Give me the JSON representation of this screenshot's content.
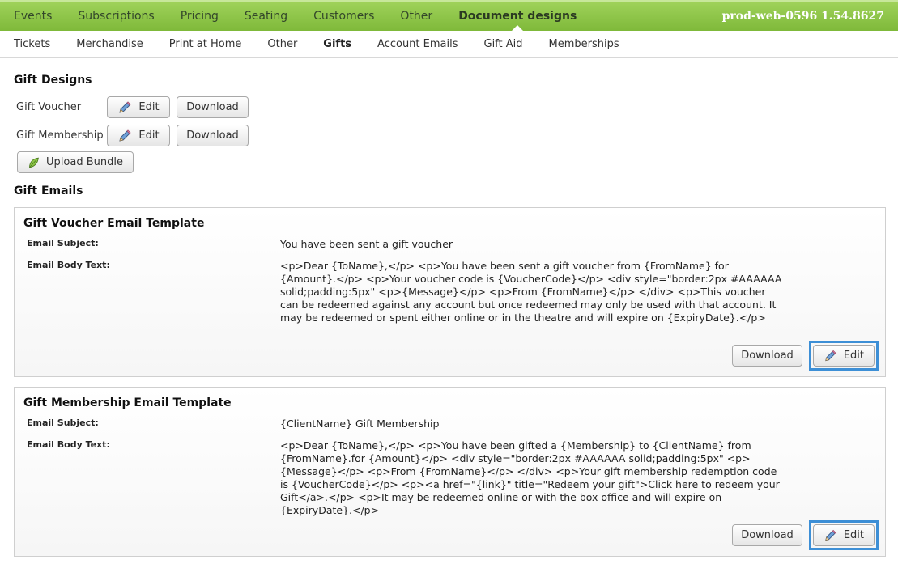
{
  "topnav": {
    "items": [
      "Events",
      "Subscriptions",
      "Pricing",
      "Seating",
      "Customers",
      "Other",
      "Document designs"
    ],
    "active_index": 6,
    "server": "prod-web-0596 1.54.8627"
  },
  "subnav": {
    "items": [
      "Tickets",
      "Merchandise",
      "Print at Home",
      "Other",
      "Gifts",
      "Account Emails",
      "Gift Aid",
      "Memberships"
    ],
    "active_index": 4
  },
  "gift_designs": {
    "title": "Gift Designs",
    "rows": [
      {
        "label": "Gift Voucher",
        "edit": "Edit",
        "download": "Download"
      },
      {
        "label": "Gift Membership",
        "edit": "Edit",
        "download": "Download"
      }
    ],
    "upload_label": "Upload Bundle"
  },
  "gift_emails": {
    "title": "Gift Emails",
    "templates": [
      {
        "title": "Gift Voucher Email Template",
        "subject_label": "Email Subject:",
        "subject": "You have been sent a gift voucher",
        "body_label": "Email Body Text:",
        "body": "<p>Dear {ToName},</p> <p>You have been sent a gift voucher from {FromName} for {Amount}.</p> <p>Your voucher code is {VoucherCode}</p> <div style=\"border:2px #AAAAAA solid;padding:5px\" <p>{Message}</p> <p>From {FromName}</p> </div> <p>This voucher can be redeemed against any account but once redeemed may only be used with that account. It may be redeemed or spent either online or in the theatre and will expire on {ExpiryDate}.</p>",
        "download": "Download",
        "edit": "Edit"
      },
      {
        "title": "Gift Membership Email Template",
        "subject_label": "Email Subject:",
        "subject": "{ClientName} Gift Membership",
        "body_label": "Email Body Text:",
        "body": "<p>Dear {ToName},</p> <p>You have been gifted a {Membership} to {ClientName} from {FromName}.for {Amount}</p> <div style=\"border:2px #AAAAAA solid;padding:5px\" <p>{Message}</p> <p>From {FromName}</p> </div> <p>Your gift membership redemption code is {VoucherCode}</p> <p><a href=\"{link}\" title=\"Redeem your gift\">Click here to redeem your Gift</a>.</p> <p>It may be redeemed online or with the box office and will expire on {ExpiryDate}.</p>",
        "download": "Download",
        "edit": "Edit"
      }
    ]
  },
  "colors": {
    "nav_green": "#8cc447",
    "highlight_blue": "#3d8fd6"
  },
  "icons": {
    "edit": "pencil-icon",
    "upload": "leaf-icon"
  }
}
